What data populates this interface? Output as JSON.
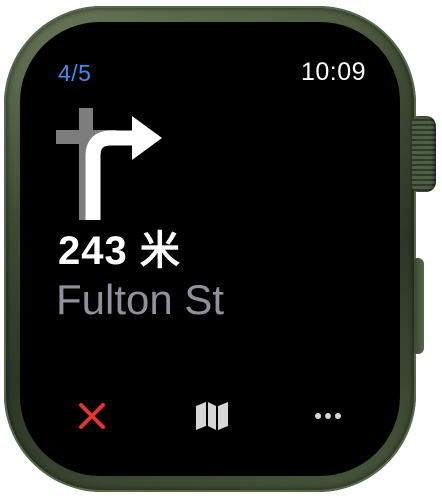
{
  "status_bar": {
    "step_counter": "4/5",
    "time": "10:09"
  },
  "navigation": {
    "maneuver_icon": "turn-right-arrow-icon",
    "distance": "243 米",
    "street": "Fulton St"
  },
  "controls": {
    "end_icon": "close-icon",
    "map_icon": "map-icon",
    "more_icon": "more-icon"
  },
  "colors": {
    "accent_blue": "#3d8cf0",
    "end_red": "#e5332a",
    "secondary_text": "#8f9099",
    "watch_case": "#3d4a33"
  }
}
